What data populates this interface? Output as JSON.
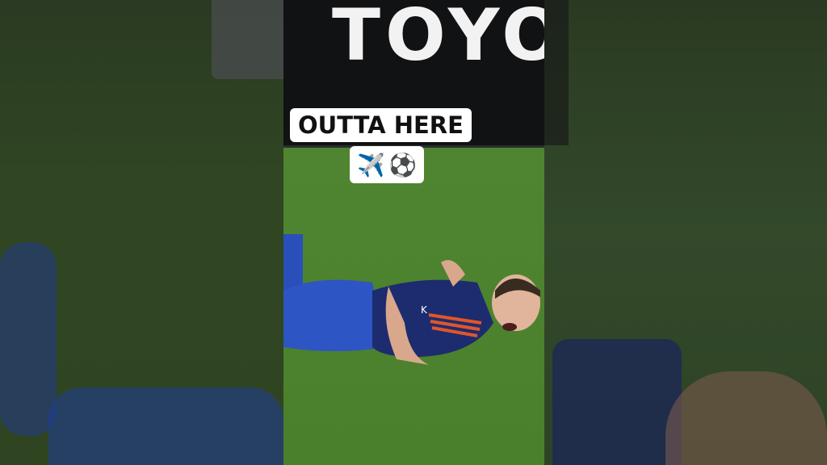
{
  "video": {
    "caption": "OUTTA HERE",
    "emoji": "✈️⚽",
    "board_text": "TOYO"
  },
  "icons": [
    "airplane-icon",
    "soccer-ball-icon"
  ]
}
